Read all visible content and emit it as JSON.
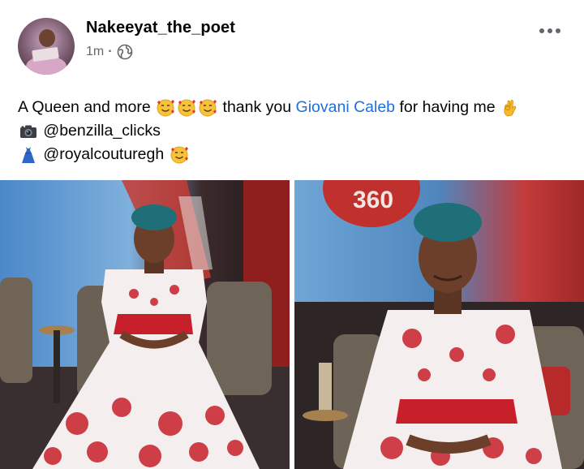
{
  "post": {
    "author": "Nakeeyat_the_poet",
    "time": "1m",
    "separator": "·",
    "privacy_icon": "globe-icon",
    "more_icon": "more-horizontal-icon",
    "text": {
      "line1_prefix": "A Queen and more",
      "line1_mid": "thank you",
      "line1_link": "Giovani Caleb",
      "line1_suffix": "for having me",
      "line2_handle": "@benzilla_clicks",
      "line3_handle": "@royalcouturegh"
    },
    "emojis": {
      "love_face": "smiling-face-with-hearts-icon",
      "ok_hand": "ok-hand-icon",
      "camera": "camera-icon",
      "dress": "dress-icon"
    },
    "photos": [
      {
        "name": "photo-girl-seated-full"
      },
      {
        "name": "photo-girl-closeup"
      }
    ],
    "studio_sign": "360"
  },
  "colors": {
    "link": "#216fdb",
    "secondary_text": "#65676b",
    "dress_red": "#c8202a",
    "headwrap_teal": "#1f6f78"
  }
}
